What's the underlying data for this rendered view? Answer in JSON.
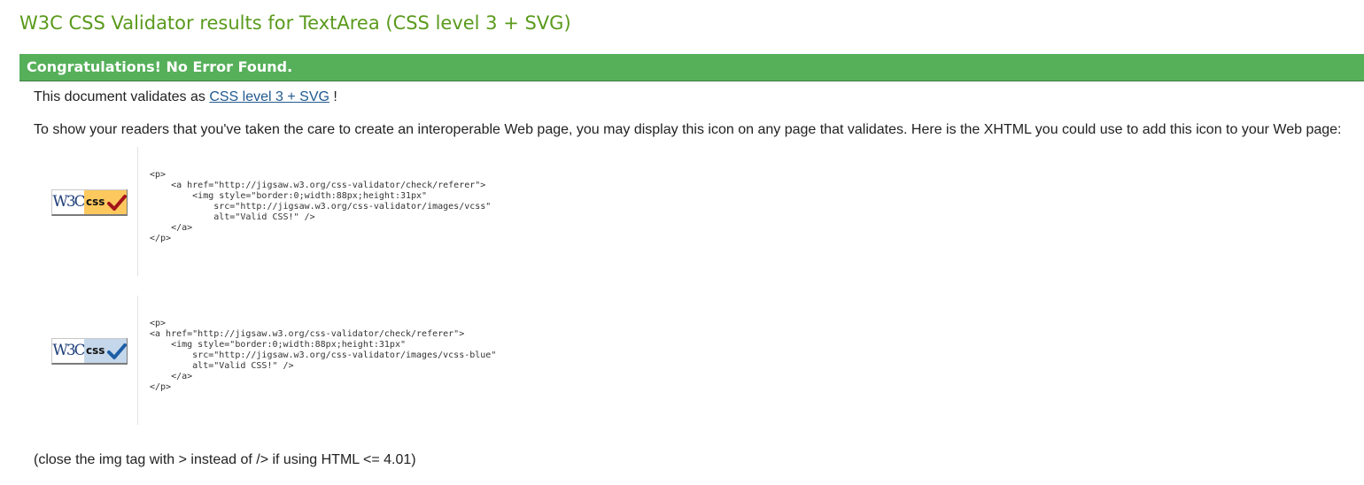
{
  "page_title": "W3C CSS Validator results for TextArea (CSS level 3 + SVG)",
  "banner": {
    "message": "Congratulations! No Error Found.",
    "color": "#56b05a"
  },
  "validates": {
    "prefix": "This document validates as ",
    "link_label": "CSS level 3 + SVG",
    "suffix": " !"
  },
  "show_readers_text": "To show your readers that you've taken the care to create an interoperable Web page, you may display this icon on any page that validates. Here is the XHTML you could use to add this icon to your Web page:",
  "icons": [
    {
      "badge_w3c": "W3C",
      "badge_css": "css",
      "badge_color": "#fdc95e",
      "check_color": "#a3141a",
      "code": "<p>\n    <a href=\"http://jigsaw.w3.org/css-validator/check/referer\">\n        <img style=\"border:0;width:88px;height:31px\"\n            src=\"http://jigsaw.w3.org/css-validator/images/vcss\"\n            alt=\"Valid CSS!\" />\n    </a>\n</p>"
    },
    {
      "badge_w3c": "W3C",
      "badge_css": "css",
      "badge_color": "#c5d7ea",
      "check_color": "#1c5ea6",
      "code": "<p>\n<a href=\"http://jigsaw.w3.org/css-validator/check/referer\">\n    <img style=\"border:0;width:88px;height:31px\"\n        src=\"http://jigsaw.w3.org/css-validator/images/vcss-blue\"\n        alt=\"Valid CSS!\" />\n    </a>\n</p>"
    }
  ],
  "close_note": "(close the img tag with > instead of /> if using HTML <= 4.01)"
}
